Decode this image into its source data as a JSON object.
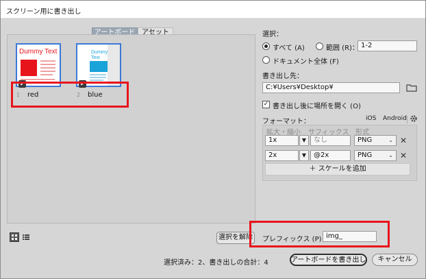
{
  "window": {
    "title": "スクリーン用に書き出し"
  },
  "tabs": [
    {
      "label": "アートボード"
    },
    {
      "label": "アセット"
    }
  ],
  "artboards": [
    {
      "number": "1",
      "name": "red",
      "thumb_heading": "Dummy Text",
      "accent": "#e8141c"
    },
    {
      "number": "2",
      "name": "blue",
      "thumb_heading": "Dummy Text",
      "accent": "#1aa3d9"
    }
  ],
  "selection": {
    "heading": "選択：",
    "all_label": "すべて (A)",
    "range_label": "範囲 (R)：",
    "range_value": "1-2",
    "whole_doc_label": "ドキュメント全体 (F)"
  },
  "export": {
    "heading": "書き出し先：",
    "path": "C:¥Users¥Desktop¥",
    "open_after_label": "書き出し後に場所を開く (O)",
    "open_after_checked": true
  },
  "format": {
    "heading": "フォーマット：",
    "ios_label": "iOS",
    "android_label": "Android",
    "col_scale": "拡大・縮小",
    "col_suffix": "サフィックス",
    "col_format": "形式",
    "rows": [
      {
        "scale": "1x",
        "suffix": "なし",
        "suffix_is_placeholder": true,
        "format": "PNG"
      },
      {
        "scale": "2x",
        "suffix": "@2x",
        "suffix_is_placeholder": false,
        "format": "PNG"
      }
    ],
    "add_scale_label": "＋ スケールを追加"
  },
  "prefix": {
    "label": "プレフィックス (P)：",
    "value": "img_"
  },
  "footer": {
    "deselect_label": "選択を解除",
    "status": "選択済み：2、書き出しの合計：4",
    "export_button": "アートボードを書き出し",
    "cancel_button": "キャンセル"
  },
  "colors": {
    "highlight": "#e8141c",
    "selection_blue": "#3b78d8"
  }
}
